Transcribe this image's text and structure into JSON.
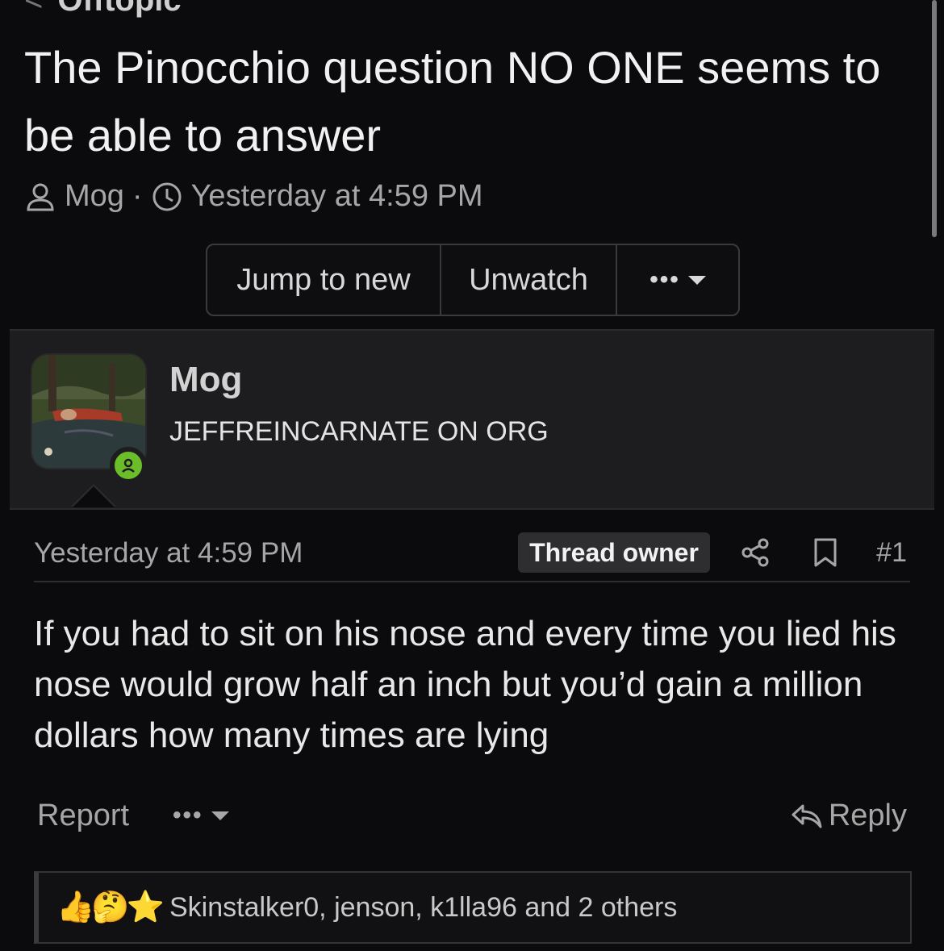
{
  "nav": {
    "back_label": "Offtopic"
  },
  "thread": {
    "title": "The Pinocchio question NO ONE seems to be able to answer",
    "author": "Mog",
    "separator": "·",
    "time": "Yesterday at 4:59 PM"
  },
  "actions": {
    "jump_label": "Jump to new",
    "unwatch_label": "Unwatch",
    "more_label": "•••"
  },
  "post": {
    "username": "Mog",
    "user_title": "JEFFREINCARNATE ON ORG",
    "time": "Yesterday at 4:59 PM",
    "badge": "Thread owner",
    "number": "#1",
    "body": "If you had to sit on his nose and every time you lied his nose would grow half an inch but you’d gain a million dollars how many times are lying",
    "report_label": "Report",
    "more_label": "•••",
    "reply_label": "Reply"
  },
  "reactions": {
    "icons": [
      "👍",
      "🤔",
      "⭐"
    ],
    "text": "Skinstalker0, jenson, k1lla96 and 2 others"
  },
  "colors": {
    "background": "#0b0b0d",
    "card": "#1d1d1f",
    "online": "#6bbd2a",
    "star": "#f5b800"
  }
}
